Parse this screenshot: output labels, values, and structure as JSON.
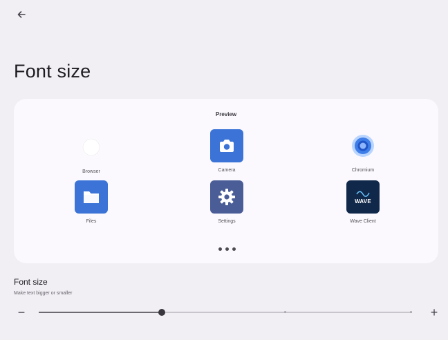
{
  "header": {
    "back_icon": "arrow-left-icon",
    "title": "Font size"
  },
  "preview": {
    "label": "Preview",
    "apps": [
      {
        "label": "Browser",
        "icon": "browser-icon"
      },
      {
        "label": "Camera",
        "icon": "camera-icon"
      },
      {
        "label": "Chromium",
        "icon": "chromium-icon"
      },
      {
        "label": "Files",
        "icon": "files-icon"
      },
      {
        "label": "Settings",
        "icon": "settings-icon"
      },
      {
        "label": "Wave Client",
        "icon": "wave-client-icon",
        "logo_text": "WAVE"
      }
    ],
    "more_icon": "more-dots-icon"
  },
  "setting": {
    "title": "Font size",
    "subtitle": "Make text bigger or smaller",
    "decrease_label": "−",
    "increase_label": "+",
    "slider": {
      "value_fraction": 0.33,
      "step_fractions": [
        0.33,
        0.66,
        1.0
      ]
    }
  },
  "colors": {
    "background": "#f1eff4",
    "card": "#fbf9fd",
    "accent": "#3b74d6",
    "settings_icon_bg": "#4a5d97",
    "wave_icon_bg": "#10284a",
    "slider_active": "#6d6a72"
  }
}
